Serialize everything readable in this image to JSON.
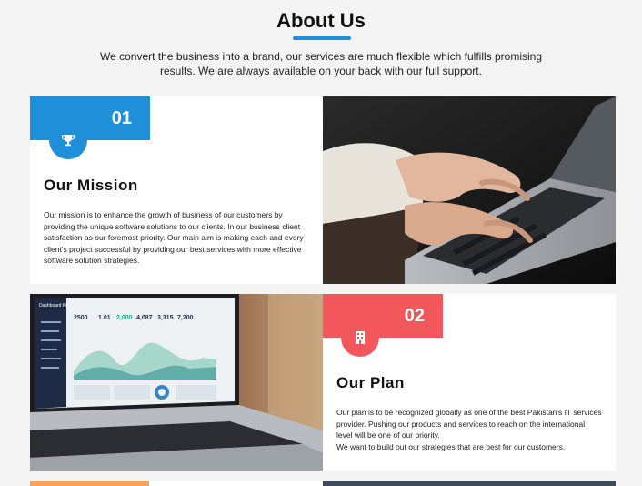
{
  "header": {
    "title": "About Us",
    "intro": "We convert the business into a brand, our services are much flexible which fulfills promising results. We are always available on your back with our full support."
  },
  "colors": {
    "accent_blue": "#1e8fd8",
    "accent_red": "#f2575c",
    "accent_orange": "#f6a25e"
  },
  "cards": [
    {
      "number": "01",
      "icon": "trophy-icon",
      "heading": "Our Mission",
      "text": "Our mission is to enhance the growth of business of our customers by providing the unique software solutions to our clients. In our business client satisfaction as our foremost priority. Our main aim is making each and every client's project successful by providing our best services with more effective software solution strategies."
    },
    {
      "number": "02",
      "icon": "building-icon",
      "heading": "Our Plan",
      "text_line1": "Our plan is to be recognized globally as one of the best Pakistan's IT services provider. Pushing our products and services to reach on the international level will be one of our priority.",
      "text_line2": "We want to build out our strategies that are best for our customers."
    }
  ],
  "dashboard": {
    "stats": [
      "2500",
      "1.01",
      "2,000",
      "4,087",
      "3,315",
      "7,200"
    ],
    "brand": "Dashboard Kit"
  }
}
